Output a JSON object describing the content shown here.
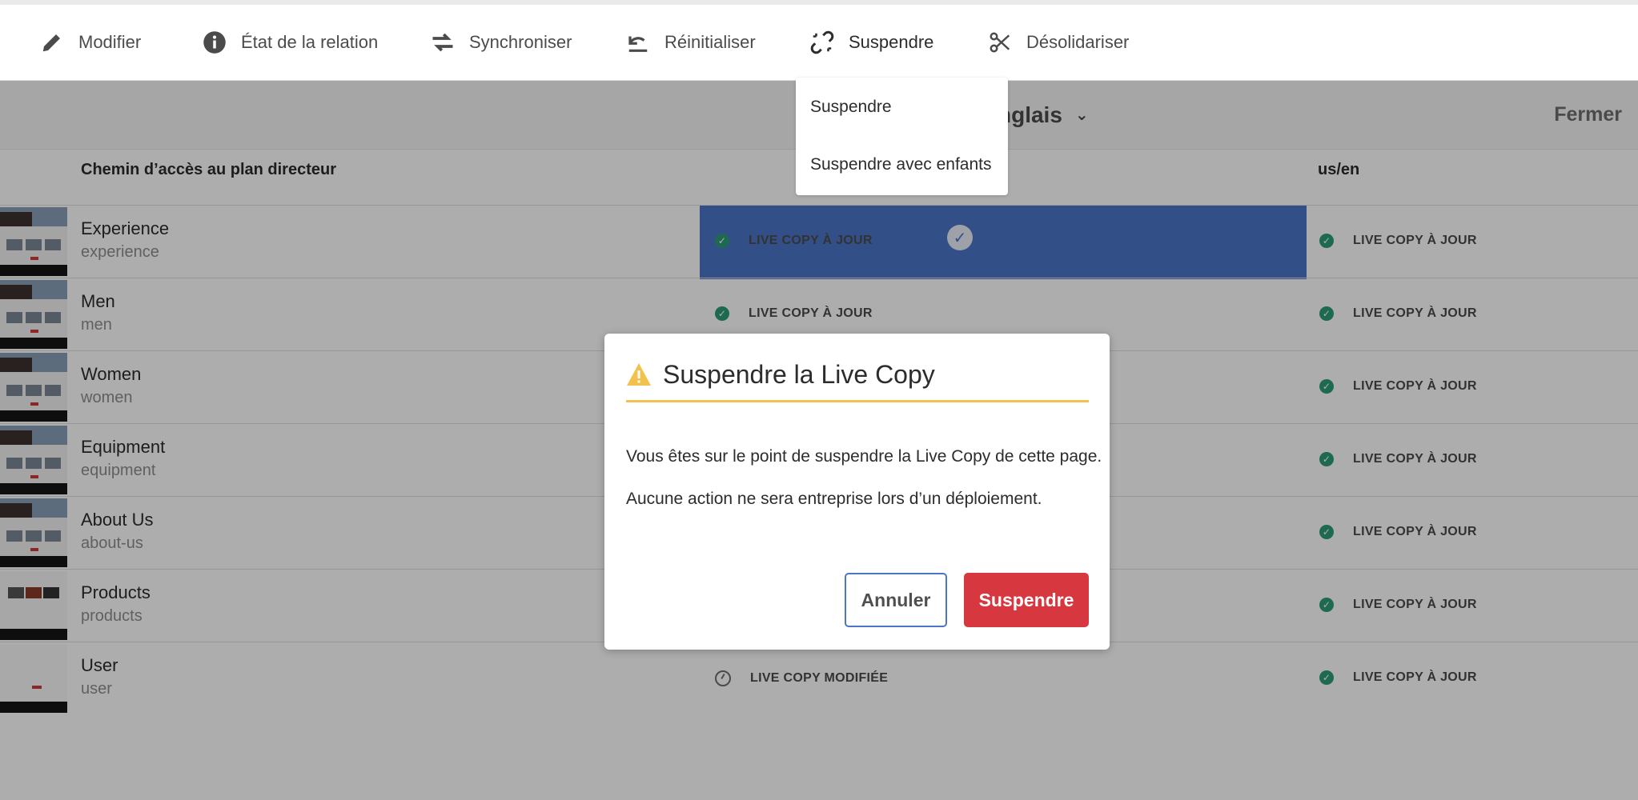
{
  "toolbar": {
    "items": [
      {
        "label": "Modifier",
        "icon": "pencil-icon"
      },
      {
        "label": "État de la relation",
        "icon": "info-icon"
      },
      {
        "label": "Synchroniser",
        "icon": "sync-arrows-icon"
      },
      {
        "label": "Réinitialiser",
        "icon": "undo-icon"
      },
      {
        "label": "Suspendre",
        "icon": "broken-link-icon"
      },
      {
        "label": "Désolidariser",
        "icon": "scissors-icon"
      }
    ]
  },
  "suspend_menu": {
    "items": [
      "Suspendre",
      "Suspendre avec enfants"
    ]
  },
  "header": {
    "language": "nglais",
    "close_label": "Fermer"
  },
  "table": {
    "col_master_path": "Chemin d’accès au plan directeur",
    "col_target": "us/en",
    "rows": [
      {
        "title": "Experience",
        "name": "experience",
        "status_a": "LIVE COPY À JOUR",
        "status_b": "LIVE COPY À JOUR"
      },
      {
        "title": "Men",
        "name": "men",
        "status_a": "LIVE COPY À JOUR",
        "status_b": "LIVE COPY À JOUR"
      },
      {
        "title": "Women",
        "name": "women",
        "status_a": "",
        "status_b": "LIVE COPY À JOUR"
      },
      {
        "title": "Equipment",
        "name": "equipment",
        "status_a": "",
        "status_b": "LIVE COPY À JOUR"
      },
      {
        "title": "About Us",
        "name": "about-us",
        "status_a": "",
        "status_b": "LIVE COPY À JOUR"
      },
      {
        "title": "Products",
        "name": "products",
        "status_a": "",
        "status_b": "LIVE COPY À JOUR"
      },
      {
        "title": "User",
        "name": "user",
        "status_a": "LIVE COPY MODIFIÉE",
        "status_b": "LIVE COPY À JOUR"
      }
    ]
  },
  "dialog": {
    "title": "Suspendre la Live Copy",
    "line1": "Vous êtes sur le point de suspendre la Live Copy de cette page.",
    "line2": "Aucune action ne sera entreprise lors d’un déploiement.",
    "cancel_label": "Annuler",
    "confirm_label": "Suspendre"
  },
  "colors": {
    "accent_blue": "#4b76c8",
    "warning_yellow": "#f2c14e",
    "danger_red": "#d7373f",
    "success_green": "#2d9d78"
  }
}
